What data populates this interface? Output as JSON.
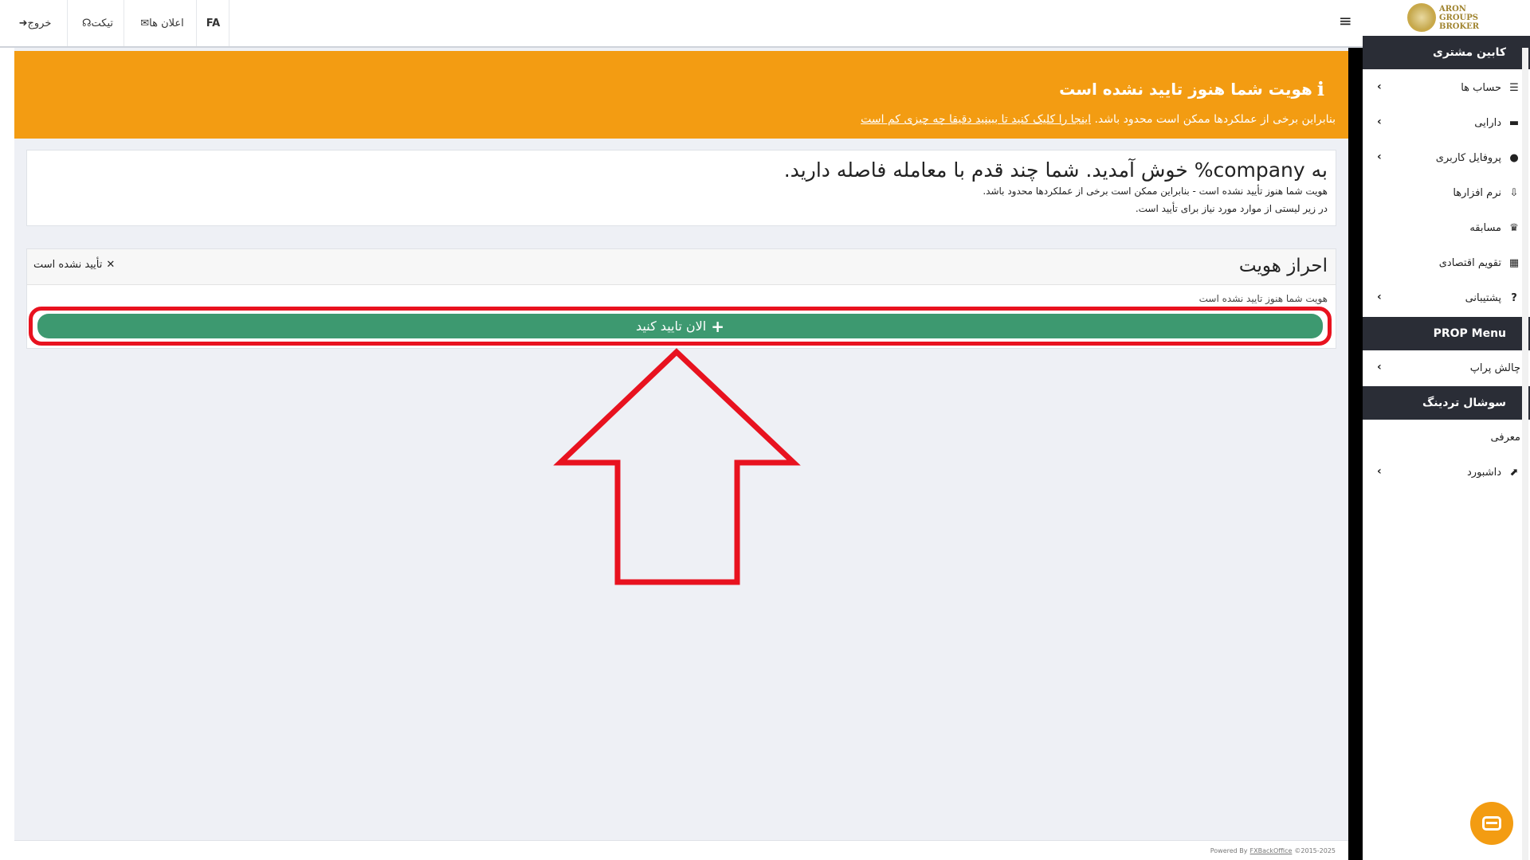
{
  "topbar": {
    "items": [
      {
        "label": "خروج",
        "icon": "sign-out-icon"
      },
      {
        "label": "تیکت",
        "icon": "support-icon"
      },
      {
        "label": "اعلان ها",
        "icon": "envelope-icon"
      },
      {
        "label": "FA"
      }
    ],
    "menu_icon": "hamburger-icon"
  },
  "sidebar": {
    "logo_lines": [
      "ARON",
      "GROUPS",
      "BROKER"
    ],
    "sections": [
      {
        "title": "کابین مشتری"
      },
      {
        "title": "PROP Menu"
      },
      {
        "title": "سوشال تردینگ"
      }
    ],
    "items": [
      {
        "label": "حساب ها",
        "icon": "list-icon",
        "has_chevron": true
      },
      {
        "label": "دارایی",
        "icon": "wallet-icon",
        "has_chevron": true
      },
      {
        "label": "پروفایل کاربری",
        "icon": "user-icon",
        "has_chevron": true
      },
      {
        "label": "نرم افزارها",
        "icon": "download-icon",
        "has_chevron": false
      },
      {
        "label": "مسابقه",
        "icon": "trophy-icon",
        "has_chevron": false
      },
      {
        "label": "تقویم اقتصادی",
        "icon": "calendar-icon",
        "has_chevron": false
      },
      {
        "label": "پشتیبانی",
        "icon": "question-icon",
        "has_chevron": true
      },
      {
        "label": "چالش پراپ",
        "icon": "",
        "has_chevron": true
      },
      {
        "label": "معرفی",
        "icon": "",
        "has_chevron": false
      },
      {
        "label": "داشبورد",
        "icon": "chart-icon",
        "has_chevron": true
      }
    ]
  },
  "alert": {
    "title": "هویت شما هنوز تایید نشده است",
    "text_before": "بنابراین برخی از عملکردها ممکن است محدود باشد.",
    "link_text": "اینجا را کلیک کنید تا ببینید دقیقا چه چیزی کم است",
    "color": "#f39c12"
  },
  "welcome": {
    "heading": "به company% خوش آمدید. شما چند قدم با معامله فاصله دارید.",
    "line1": "هویت شما هنوز تأیید نشده است - بنابراین ممکن است برخی از عملکردها محدود باشد.",
    "line2": "در زیر لیستی از موارد مورد نیاز برای تأیید است."
  },
  "verification": {
    "title": "احراز هویت",
    "status": "تأیید نشده است",
    "subtext": "هویت شما هنوز تایید نشده است",
    "button_label": "الان تایید کنید",
    "button_color": "#3d9970",
    "highlight_color": "#e8121f"
  },
  "footer": {
    "powered": "Powered By",
    "link": "FXBackOffice",
    "copyright": "©2015-2025"
  }
}
